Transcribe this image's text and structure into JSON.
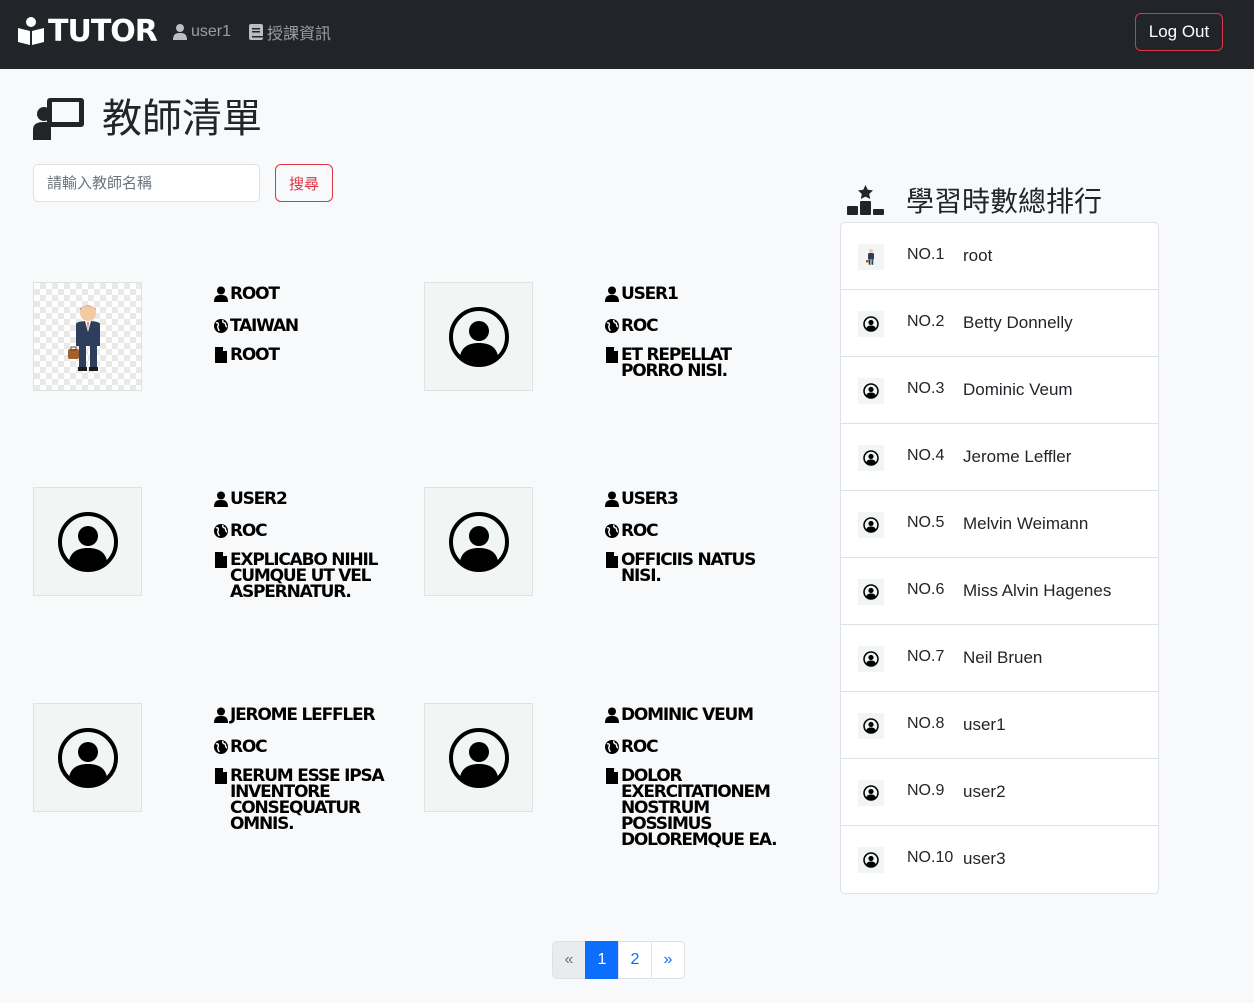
{
  "navbar": {
    "brand": "TUTOR",
    "user_link": "user1",
    "info_link": "授課資訊",
    "logout": "Log Out"
  },
  "page": {
    "title": "教師清單",
    "search_placeholder": "請輸入教師名稱",
    "search_button": "搜尋"
  },
  "teachers": [
    {
      "name": "root",
      "country": "Taiwan",
      "desc": "root",
      "avatar": "tutor-photo"
    },
    {
      "name": "user1",
      "country": "ROC",
      "desc": "Et repellat porro nisi.",
      "avatar": "default-user-icon"
    },
    {
      "name": "user2",
      "country": "ROC",
      "desc": "Explicabo nihil cumque ut vel aspernatur.",
      "avatar": "default-user-icon"
    },
    {
      "name": "user3",
      "country": "ROC",
      "desc": "Officiis natus nisi.",
      "avatar": "default-user-icon"
    },
    {
      "name": "Jerome Leffler",
      "country": "ROC",
      "desc": "Rerum esse ipsa inventore consequatur omnis.",
      "avatar": "default-user-icon"
    },
    {
      "name": "Dominic Veum",
      "country": "ROC",
      "desc": "Dolor exercitationem nostrum possimus doloremque ea.",
      "avatar": "default-user-icon"
    }
  ],
  "ranking": {
    "title": "學習時數總排行",
    "items": [
      {
        "no": "NO.1",
        "name": "root"
      },
      {
        "no": "NO.2",
        "name": "Betty Donnelly"
      },
      {
        "no": "NO.3",
        "name": "Dominic Veum"
      },
      {
        "no": "NO.4",
        "name": "Jerome Leffler"
      },
      {
        "no": "NO.5",
        "name": "Melvin Weimann"
      },
      {
        "no": "NO.6",
        "name": "Miss Alvin Hagenes"
      },
      {
        "no": "NO.7",
        "name": "Neil Bruen"
      },
      {
        "no": "NO.8",
        "name": "user1"
      },
      {
        "no": "NO.9",
        "name": "user2"
      },
      {
        "no": "NO.10",
        "name": "user3"
      }
    ]
  },
  "pagination": {
    "prev": "«",
    "pages": [
      "1",
      "2"
    ],
    "active": "1",
    "next": "»"
  }
}
